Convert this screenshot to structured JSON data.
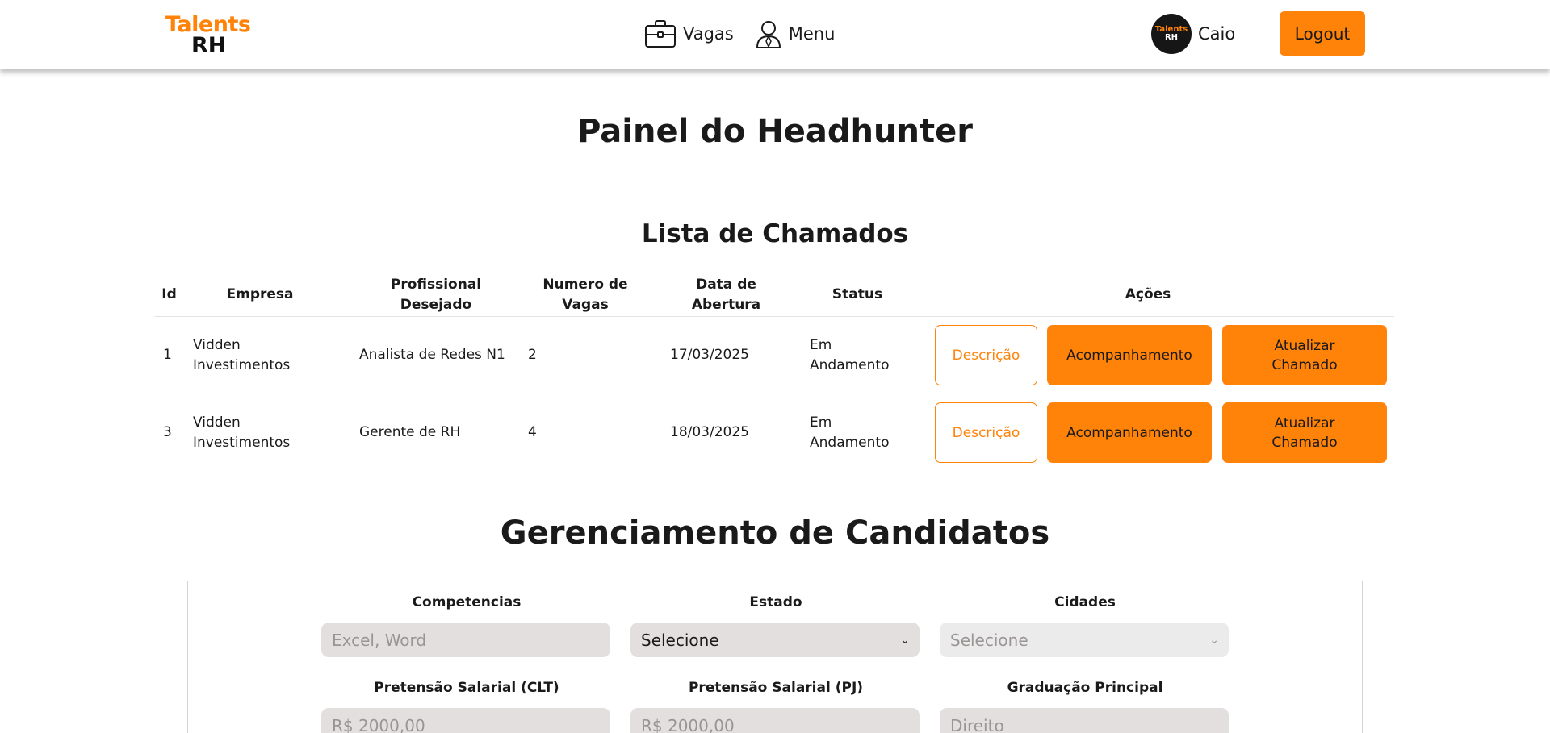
{
  "header": {
    "logo_top": "Talents",
    "logo_bottom": "RH",
    "nav": [
      {
        "label": "Vagas",
        "icon": "briefcase-icon"
      },
      {
        "label": "Menu",
        "icon": "user-icon"
      }
    ],
    "avatar_top": "Talents",
    "avatar_bottom": "RH",
    "username": "Caio",
    "logout": "Logout"
  },
  "page_title": "Painel do Headhunter",
  "chamados": {
    "title": "Lista de Chamados",
    "columns": {
      "id": "Id",
      "empresa": "Empresa",
      "profissional_1": "Profissional",
      "profissional_2": "Desejado",
      "vagas_1": "Numero de",
      "vagas_2": "Vagas",
      "data_1": "Data de",
      "data_2": "Abertura",
      "status": "Status",
      "acoes": "Ações"
    },
    "rows": [
      {
        "id": "1",
        "empresa_1": "Vidden",
        "empresa_2": "Investimentos",
        "profissional": "Analista de Redes N1",
        "vagas": "2",
        "data": "17/03/2025",
        "status_1": "Em",
        "status_2": "Andamento"
      },
      {
        "id": "3",
        "empresa_1": "Vidden",
        "empresa_2": "Investimentos",
        "profissional": "Gerente de RH",
        "vagas": "4",
        "data": "18/03/2025",
        "status_1": "Em",
        "status_2": "Andamento"
      }
    ],
    "actions": {
      "descricao": "Descrição",
      "acompanhamento": "Acompanhamento",
      "atualizar_1": "Atualizar",
      "atualizar_2": "Chamado"
    }
  },
  "candidatos": {
    "title": "Gerenciamento de Candidatos",
    "fields": {
      "competencias": {
        "label": "Competencias",
        "placeholder": "Excel, Word"
      },
      "estado": {
        "label": "Estado",
        "value": "Selecione"
      },
      "cidades": {
        "label": "Cidades",
        "value": "Selecione"
      },
      "clt": {
        "label": "Pretensão Salarial (CLT)",
        "placeholder": "R$ 2000,00"
      },
      "pj": {
        "label": "Pretensão Salarial (PJ)",
        "placeholder": "R$ 2000,00"
      },
      "graduacao": {
        "label": "Graduação Principal",
        "placeholder": "Direito"
      }
    }
  },
  "colors": {
    "accent": "#ff8209",
    "text": "#1a1a1a",
    "input_bg": "#e4dfdf"
  }
}
